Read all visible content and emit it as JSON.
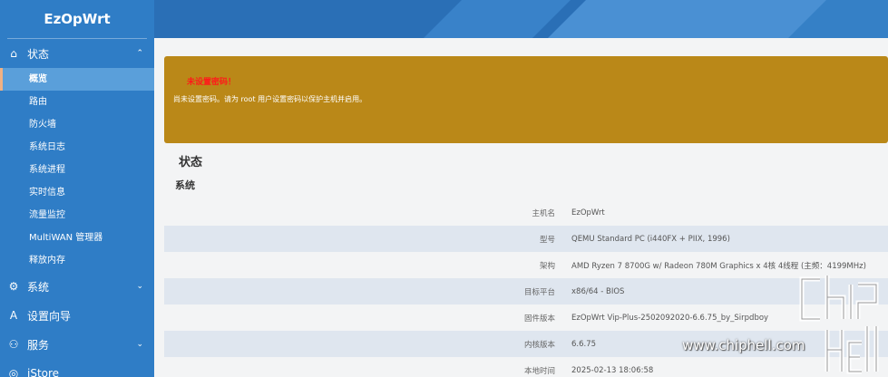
{
  "app": {
    "brand": "EzOpWrt"
  },
  "sidebar": {
    "sections": [
      {
        "label": "状态",
        "icon": "home-icon",
        "glyph": "⌂",
        "chevron": "⌃"
      },
      {
        "label": "系统",
        "icon": "gear-icon",
        "glyph": "⚙",
        "chevron": "⌄"
      },
      {
        "label": "设置向导",
        "icon": "wizard-icon",
        "glyph": "A"
      },
      {
        "label": "服务",
        "icon": "services-icon",
        "glyph": "⚇",
        "chevron": "⌄"
      },
      {
        "label": "iStore",
        "icon": "store-icon",
        "glyph": "◎"
      }
    ],
    "status_items": [
      "概览",
      "路由",
      "防火墙",
      "系统日志",
      "系统进程",
      "实时信息",
      "流量监控",
      "MultiWAN 管理器",
      "释放内存"
    ]
  },
  "alert": {
    "title": "未设置密码！",
    "message": "尚未设置密码。请为 root 用户设置密码以保护主机并启用。"
  },
  "main": {
    "heading": "状态",
    "subheading": "系统"
  },
  "system_table": [
    {
      "key": "主机名",
      "value": "EzOpWrt"
    },
    {
      "key": "型号",
      "value": "QEMU Standard PC (i440FX + PIIX, 1996)"
    },
    {
      "key": "架构",
      "value": "AMD Ryzen 7 8700G w/ Radeon 780M Graphics x 4核 4线程 (主频：4199MHz)"
    },
    {
      "key": "目标平台",
      "value": "x86/64 - BIOS"
    },
    {
      "key": "固件版本",
      "value": "EzOpWrt Vip-Plus-2502092020-6.6.75_by_Sirpdboy"
    },
    {
      "key": "内核版本",
      "value": "6.6.75"
    },
    {
      "key": "本地时间",
      "value": "2025-02-13 18:06:58"
    }
  ],
  "watermark": {
    "text": "www.chiphell.com"
  },
  "colors": {
    "sidebar": "#2f7dc6",
    "header": "#2a6fb6",
    "alert_bg": "#ba8818",
    "alert_title": "#ff1a1a",
    "active_marker": "#f0b184"
  }
}
